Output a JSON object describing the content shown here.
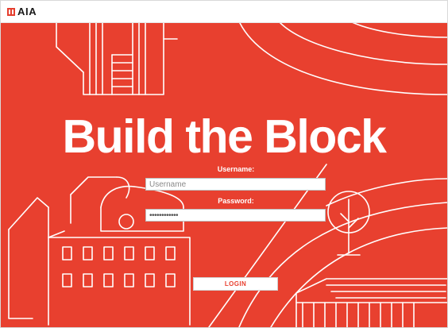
{
  "header": {
    "logo_text": "AIA",
    "logo_color": "#e53e2e"
  },
  "hero": {
    "background": "#e8402f",
    "title": "Build the Block"
  },
  "login_form": {
    "username_label": "Username:",
    "username_placeholder": "Username",
    "username_value": "",
    "password_label": "Password:",
    "password_value": "••••••••••••",
    "login_label": "LOGIN"
  }
}
